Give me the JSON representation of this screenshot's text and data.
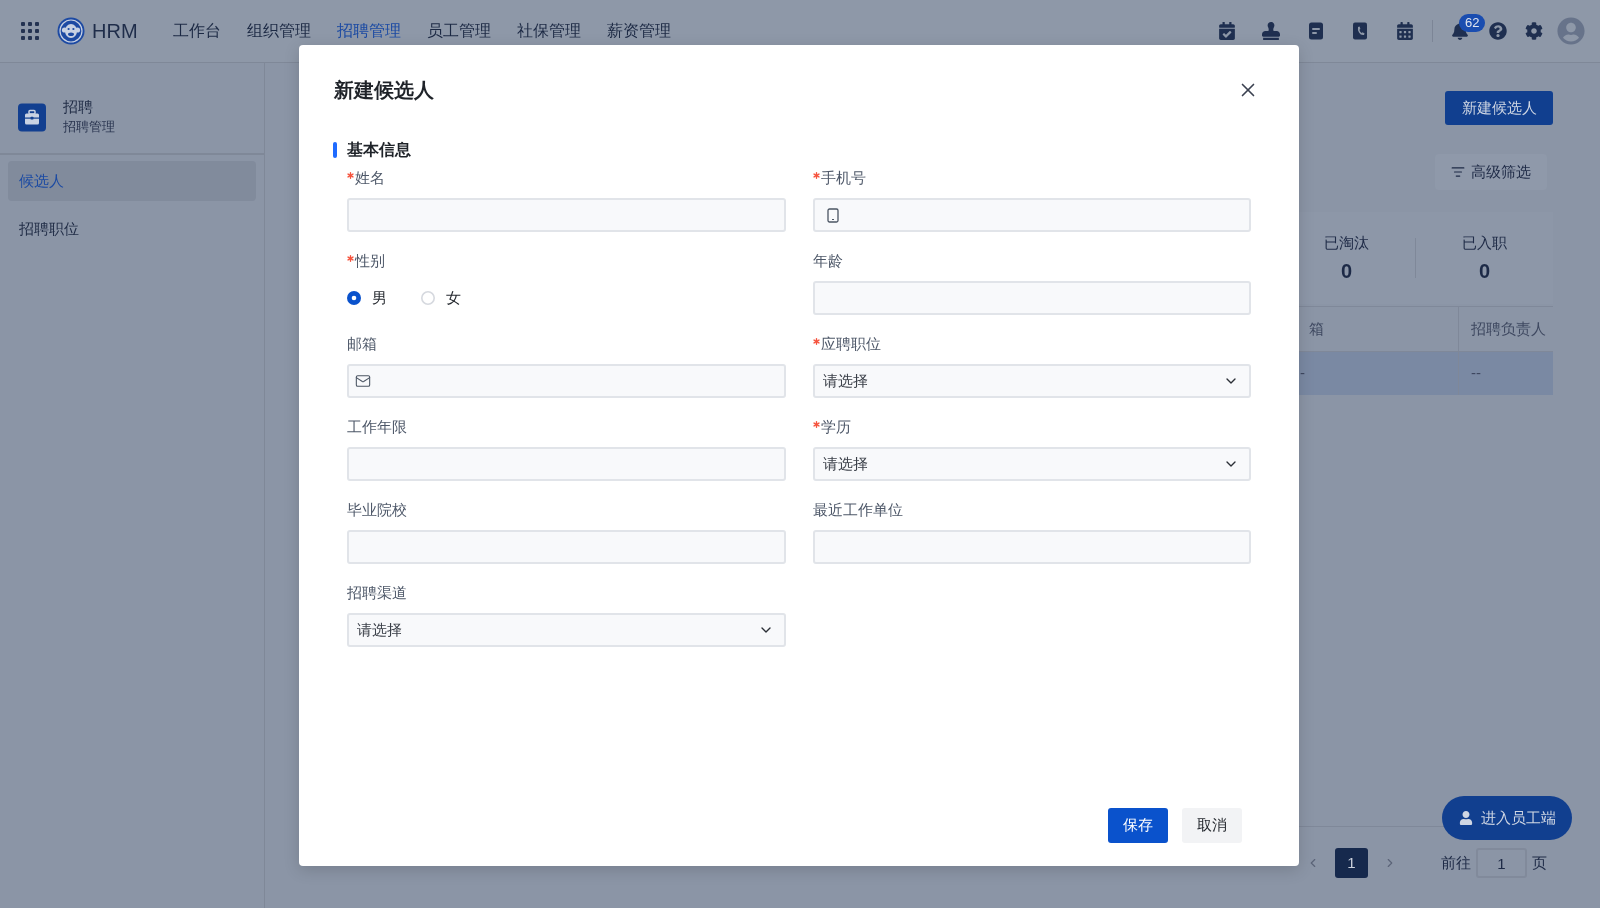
{
  "topbar": {
    "brand": "HRM",
    "nav": [
      {
        "label": "工作台",
        "selected": false
      },
      {
        "label": "组织管理",
        "selected": false
      },
      {
        "label": "招聘管理",
        "selected": true
      },
      {
        "label": "员工管理",
        "selected": false
      },
      {
        "label": "社保管理",
        "selected": false
      },
      {
        "label": "薪资管理",
        "selected": false
      }
    ],
    "notification_count": "62"
  },
  "sidebar": {
    "title": "招聘",
    "subtitle": "招聘管理",
    "items": [
      {
        "label": "候选人",
        "selected": true
      },
      {
        "label": "招聘职位",
        "selected": false
      }
    ]
  },
  "main": {
    "new_button": "新建候选人",
    "filter_button": "高级筛选",
    "stats": [
      {
        "label": "已淘汰",
        "value": "0"
      },
      {
        "label": "已入职",
        "value": "0"
      }
    ],
    "table": {
      "columns": [
        "箱",
        "招聘负责人"
      ],
      "rows": [
        {
          "cells": [
            "-",
            "--"
          ],
          "selected": true
        }
      ]
    },
    "pagination": {
      "pages": [
        {
          "label": "1",
          "selected": true
        }
      ],
      "goto_label": "前往",
      "goto_value": "1",
      "goto_suffix": "页"
    },
    "portal_button": "进入员工端"
  },
  "dialog": {
    "title": "新建候选人",
    "section": "基本信息",
    "fields": [
      {
        "label": "姓名",
        "required": true,
        "kind": "text"
      },
      {
        "label": "手机号",
        "required": true,
        "kind": "phone"
      },
      {
        "label": "性别",
        "required": true,
        "kind": "radio",
        "options": [
          {
            "label": "男",
            "selected": true
          },
          {
            "label": "女",
            "selected": false
          }
        ]
      },
      {
        "label": "年龄",
        "required": false,
        "kind": "text"
      },
      {
        "label": "邮箱",
        "required": false,
        "kind": "email"
      },
      {
        "label": "应聘职位",
        "required": true,
        "kind": "select",
        "placeholder": "请选择"
      },
      {
        "label": "工作年限",
        "required": false,
        "kind": "text"
      },
      {
        "label": "学历",
        "required": true,
        "kind": "select",
        "placeholder": "请选择"
      },
      {
        "label": "毕业院校",
        "required": false,
        "kind": "text"
      },
      {
        "label": "最近工作单位",
        "required": false,
        "kind": "text"
      },
      {
        "label": "招聘渠道",
        "required": false,
        "kind": "select",
        "placeholder": "请选择"
      }
    ],
    "buttons": [
      {
        "label": "保存",
        "kind": "primary"
      },
      {
        "label": "取消",
        "kind": "secondary"
      }
    ]
  }
}
